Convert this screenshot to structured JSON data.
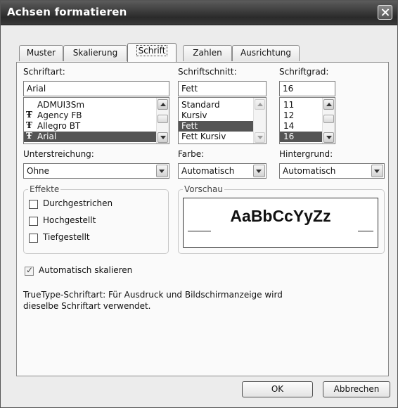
{
  "window": {
    "title": "Achsen formatieren"
  },
  "tabs": [
    "Muster",
    "Skalierung",
    "Schrift",
    "Zahlen",
    "Ausrichtung"
  ],
  "font": {
    "label": "Schriftart:",
    "value": "Arial",
    "items": [
      {
        "name": "ADMUI3Sm",
        "icon": ""
      },
      {
        "name": "Agency FB",
        "icon": "truetype-icon"
      },
      {
        "name": "Allegro BT",
        "icon": "truetype-icon"
      },
      {
        "name": "Arial",
        "icon": "truetype-icon",
        "selected": true
      }
    ]
  },
  "style": {
    "label": "Schriftschnitt:",
    "value": "Fett",
    "items": [
      "Standard",
      "Kursiv",
      "Fett",
      "Fett Kursiv"
    ],
    "selected_index": 2
  },
  "size": {
    "label": "Schriftgrad:",
    "value": "16",
    "items": [
      "11",
      "12",
      "14",
      "16"
    ],
    "selected_index": 3
  },
  "underline": {
    "label": "Unterstreichung:",
    "value": "Ohne"
  },
  "color": {
    "label": "Farbe:",
    "value": "Automatisch"
  },
  "background": {
    "label": "Hintergrund:",
    "value": "Automatisch"
  },
  "effects": {
    "title": "Effekte",
    "items": [
      {
        "label": "Durchgestrichen",
        "checked": false
      },
      {
        "label": "Hochgestellt",
        "checked": false
      },
      {
        "label": "Tiefgestellt",
        "checked": false
      }
    ]
  },
  "preview": {
    "title": "Vorschau",
    "sample": "AaBbCcYyZz"
  },
  "autoscale": {
    "label": "Automatisch skalieren",
    "checked": true
  },
  "info_text": "TrueType-Schriftart: Für Ausdruck und Bildschirmanzeige wird dieselbe Schriftart verwendet.",
  "buttons": {
    "ok": "OK",
    "cancel": "Abbrechen"
  }
}
